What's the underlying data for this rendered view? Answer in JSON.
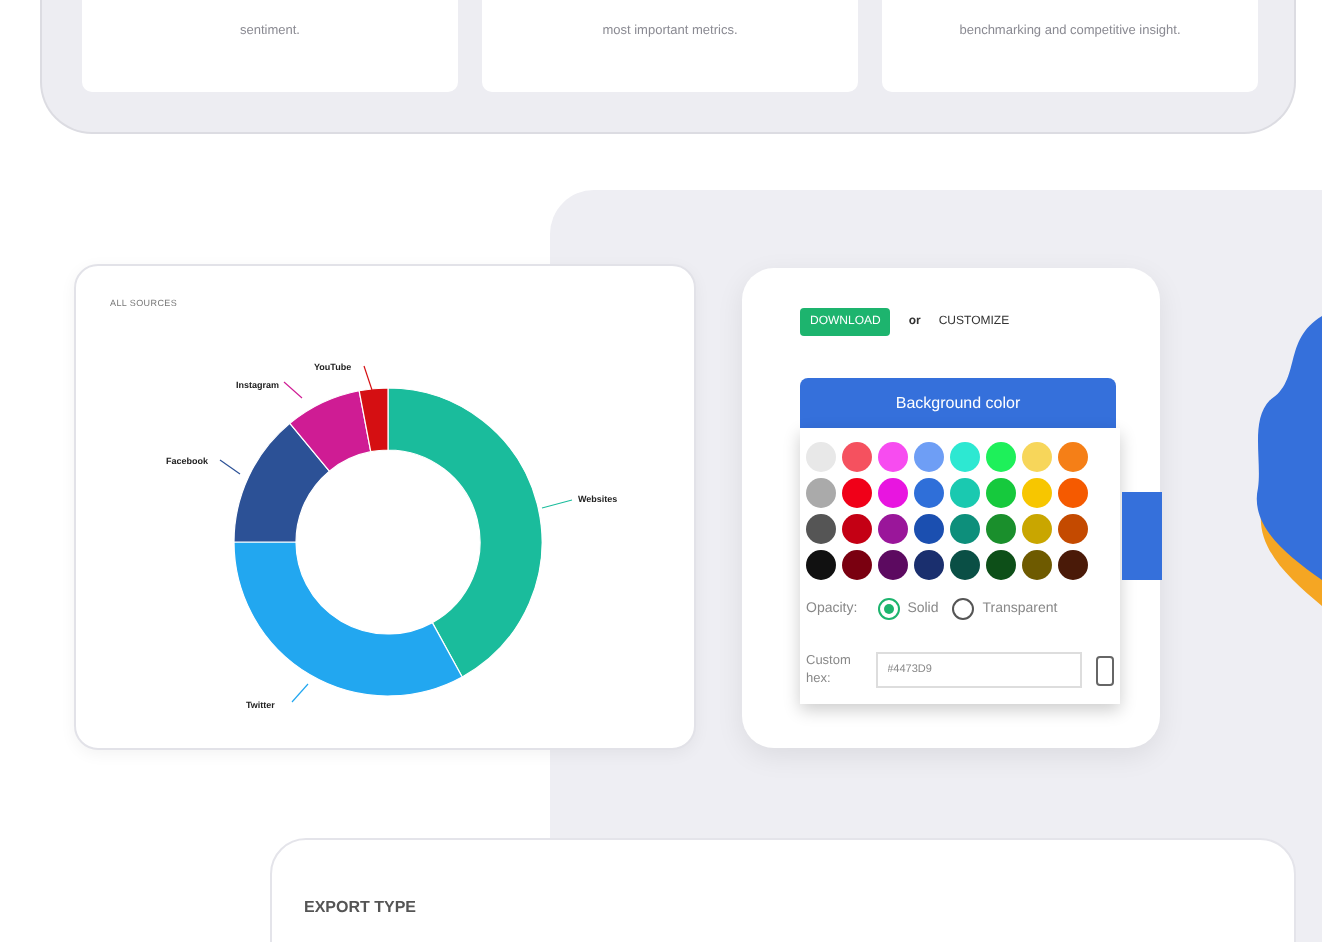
{
  "feature_cards": [
    {
      "text": "sentiment."
    },
    {
      "text": "most important metrics."
    },
    {
      "text": "benchmarking and competitive insight."
    }
  ],
  "chart_card": {
    "title": "ALL SOURCES",
    "slices": [
      {
        "label": "Websites",
        "color": "#1abc9c"
      },
      {
        "label": "Twitter",
        "color": "#22a7f0"
      },
      {
        "label": "Facebook",
        "color": "#2c5196"
      },
      {
        "label": "Instagram",
        "color": "#cf1c94"
      },
      {
        "label": "YouTube",
        "color": "#d50f12"
      }
    ]
  },
  "customize_card": {
    "download_button": "DOWNLOAD",
    "or": "or",
    "customize": "CUSTOMIZE",
    "background_button": "Background color",
    "swatches": [
      {
        "color": "#e8e8e8"
      },
      {
        "color": "#f5515f"
      },
      {
        "color": "#f74cf0"
      },
      {
        "color": "#6e9ef5"
      },
      {
        "color": "#2de8d2"
      },
      {
        "color": "#1ef05a"
      },
      {
        "color": "#f7d65a"
      },
      {
        "color": "#f57f17"
      },
      {
        "color": "#aaaaaa"
      },
      {
        "color": "#f00018"
      },
      {
        "color": "#e815e0"
      },
      {
        "color": "#2f6fd9"
      },
      {
        "color": "#1ac9b0"
      },
      {
        "color": "#16c93d"
      },
      {
        "color": "#f7c600"
      },
      {
        "color": "#f55a00"
      },
      {
        "color": "#555555"
      },
      {
        "color": "#c40014"
      },
      {
        "color": "#9a169a"
      },
      {
        "color": "#1b4fb0"
      },
      {
        "color": "#0d8f7b"
      },
      {
        "color": "#1a8f2c"
      },
      {
        "color": "#c9a600"
      },
      {
        "color": "#c44a00"
      },
      {
        "color": "#111111"
      },
      {
        "color": "#7a0010"
      },
      {
        "color": "#5c0a60"
      },
      {
        "color": "#1a2f6e"
      },
      {
        "color": "#0a4f45"
      },
      {
        "color": "#0d4f18"
      },
      {
        "color": "#6e5a00"
      },
      {
        "color": "#4a1a08"
      }
    ],
    "opacity_label": "Opacity:",
    "opacity_options": [
      {
        "label": "Solid",
        "selected": true
      },
      {
        "label": "Transparent",
        "selected": false
      }
    ],
    "custom_hex_label": "Custom hex:",
    "custom_hex_value": "#4473D9"
  },
  "export_card": {
    "title": "EXPORT TYPE"
  }
}
